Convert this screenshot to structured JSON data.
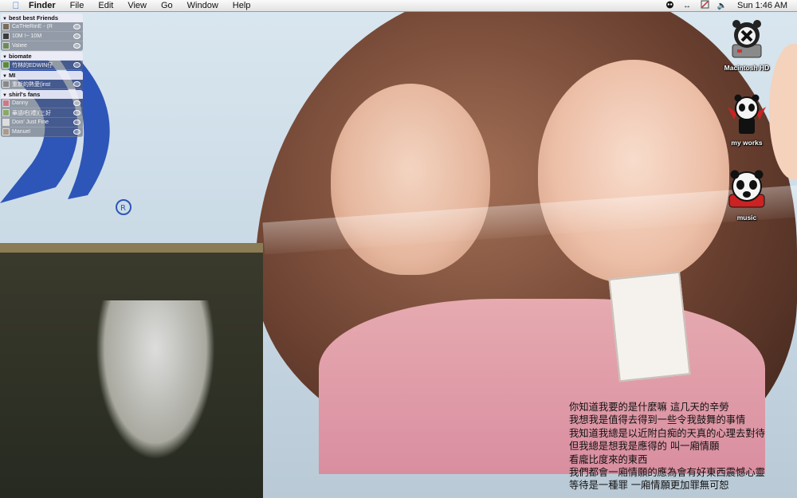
{
  "menubar": {
    "apple_icon": "apple-icon",
    "app_name": "Finder",
    "menus": [
      "File",
      "Edit",
      "View",
      "Go",
      "Window",
      "Help"
    ],
    "status_icons": [
      "panda-status-icon",
      "sync-arrows-icon",
      "script-icon",
      "volume-icon"
    ],
    "clock": "Sun 1:46 AM"
  },
  "buddy_list": {
    "groups": [
      {
        "name": "best best Friends",
        "buddies": [
          "CaTHeRinE - (R",
          "10M !~ 10M",
          "Valiee"
        ]
      },
      {
        "name": "biomate",
        "buddies": [
          "竹林的EDWIN仔"
        ]
      },
      {
        "name": "MI",
        "buddies": [
          "重新的熱愛(inst"
        ]
      },
      {
        "name": "shirl's fans",
        "buddies": [
          "Danny",
          "華語吧(禮)(三好",
          "Doin' Just Fine",
          "Manuel"
        ]
      }
    ]
  },
  "desktop_icons": [
    {
      "label": "Macintosh HD",
      "icon": "panda-robot-hd-icon"
    },
    {
      "label": "my works",
      "icon": "panda-devil-icon"
    },
    {
      "label": "music",
      "icon": "panda-music-icon"
    }
  ],
  "lyrics": [
    "你知道我要的是什麼嘛 這几天的辛勞",
    "我想我是值得去得到一些令我鼓舞的事情",
    "我知道我總是以近附白痴的天真的心理去對待",
    "但我總是想我是應得的 叫一廂情願",
    "看龐比度來的東西",
    "我們都會一廂情願的應為會有好東西震憾心靈",
    "等待是一種罪 一廂情願更加罪無可恕"
  ],
  "colors": {
    "menubar_bg": "#ececec",
    "accent_blue": "#3b7dd8",
    "logo_blue": "#2d56b8"
  }
}
